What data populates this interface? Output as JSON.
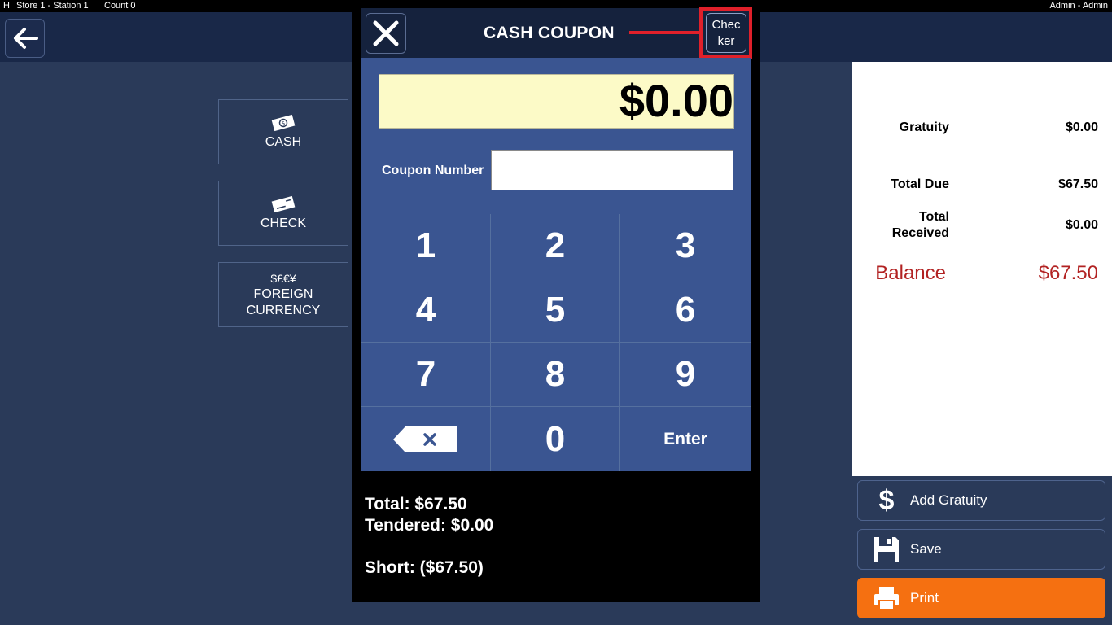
{
  "topbar": {
    "left_letter": "H",
    "station": "Store 1 - Station 1",
    "count": "Count 0",
    "user": "Admin - Admin"
  },
  "tenders": [
    {
      "label": "CASH",
      "icon": "cash-icon"
    },
    {
      "label": "CHECK",
      "icon": "check-icon"
    },
    {
      "label_line1": "FOREIGN",
      "label_line2": "CURRENCY",
      "symbols": "$£€¥"
    }
  ],
  "modal": {
    "title": "CASH COUPON",
    "checker_line1": "Chec",
    "checker_line2": "ker",
    "amount": "$0.00",
    "coupon_label": "Coupon Number",
    "coupon_value": "",
    "keys": [
      "1",
      "2",
      "3",
      "4",
      "5",
      "6",
      "7",
      "8",
      "9",
      "0"
    ],
    "enter_label": "Enter",
    "total": "Total: $67.50",
    "tendered": "Tendered: $0.00",
    "short": "Short: ($67.50)"
  },
  "summary": {
    "gratuity_label": "Gratuity",
    "gratuity_value": "$0.00",
    "total_due_label": "Total Due",
    "total_due_value": "$67.50",
    "received_line1": "Total",
    "received_line2": "Received",
    "received_value": "$0.00",
    "balance_label": "Balance",
    "balance_value": "$67.50"
  },
  "actions": {
    "gratuity": "Add Gratuity",
    "save": "Save",
    "print": "Print"
  },
  "colors": {
    "background": "#2a3a59",
    "header": "#192848",
    "keypad": "#3a5591",
    "amount_bg": "#fcfac7",
    "balance": "#b22222",
    "print": "#f57011",
    "highlight": "#e0202a"
  }
}
